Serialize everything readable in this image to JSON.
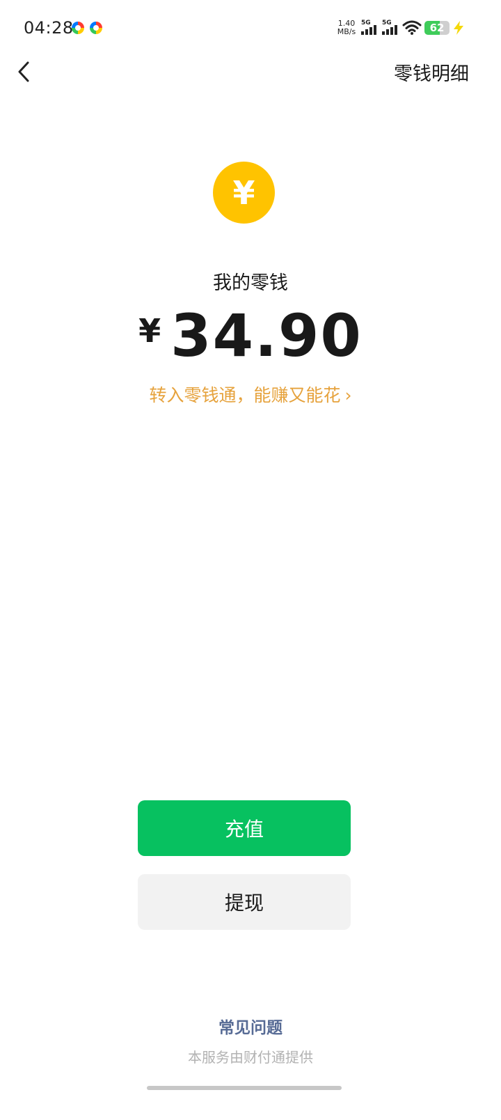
{
  "status_bar": {
    "time": "04:28",
    "net_speed_value": "1.40",
    "net_speed_unit": "MB/s",
    "sim1_label": "5G",
    "sim2_label": "5G",
    "battery_level": "62",
    "battery_fraction": 0.62
  },
  "nav": {
    "detail_label": "零钱明细"
  },
  "wallet": {
    "coin_symbol": "¥",
    "balance_label": "我的零钱",
    "currency_symbol": "¥",
    "balance_amount": "34.90",
    "promo_text": "转入零钱通，能赚又能花",
    "promo_chevron": "›"
  },
  "actions": {
    "recharge_label": "充值",
    "withdraw_label": "提现"
  },
  "footer": {
    "faq_label": "常见问题",
    "provider_text": "本服务由财付通提供"
  },
  "colors": {
    "primary_green": "#07c160",
    "coin_yellow": "#ffc300",
    "promo_orange": "#e6a23c",
    "link_blue": "#576b95",
    "battery_green": "#3fcc5a"
  }
}
